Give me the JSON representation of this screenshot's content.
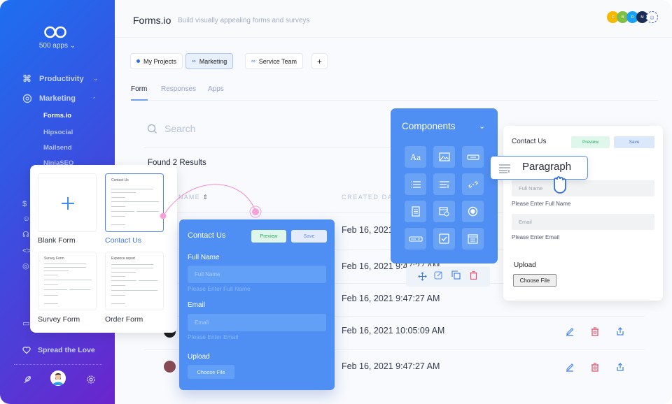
{
  "sidebar": {
    "apps_label": "500 apps",
    "nav": [
      {
        "label": "Productivity",
        "icon": "command-icon",
        "expanded": false
      },
      {
        "label": "Marketing",
        "icon": "compass-icon",
        "expanded": true
      }
    ],
    "sub_items": [
      {
        "label": "Forms.io",
        "active": true
      },
      {
        "label": "Hipsocial",
        "active": false
      },
      {
        "label": "Mailsend",
        "active": false
      },
      {
        "label": "NinjaSEO",
        "active": false
      }
    ],
    "spread_label": "Spread the Love"
  },
  "header": {
    "title": "Forms.io",
    "subtitle": "Build visually appealing forms and surveys",
    "avatars": [
      {
        "initial": "C",
        "color": "#f7b900"
      },
      {
        "initial": "B",
        "color": "#7fc043"
      },
      {
        "initial": "R",
        "color": "#1aa3f5"
      },
      {
        "initial": "M",
        "color": "#1c2d55"
      }
    ]
  },
  "workspaces": {
    "items": [
      {
        "label": "My Projects",
        "active": false
      },
      {
        "label": "Marketing",
        "active": true
      },
      {
        "label": "Service Team",
        "active": false
      }
    ],
    "add_label": "+"
  },
  "tabs": [
    {
      "label": "Form",
      "active": true
    },
    {
      "label": "Responses",
      "active": false
    },
    {
      "label": "Apps",
      "active": false
    }
  ],
  "search": {
    "placeholder": "Search"
  },
  "results": {
    "found_label": "Found 2 Results",
    "columns": {
      "name": "NAME",
      "created": "CREATED DATE"
    },
    "rows": [
      {
        "created": "Feb 16, 2021 9:47:27 AM"
      },
      {
        "created": "Feb 16, 2021 9:47:27 AM"
      },
      {
        "created": "Feb 16, 2021 9:47:27 AM"
      },
      {
        "created": "Feb 16, 2021 10:05:09 AM"
      },
      {
        "created": "Feb 16, 2021 9:47:27 AM"
      }
    ]
  },
  "templates": [
    {
      "label": "Blank Form",
      "preview_title": "",
      "selected": false
    },
    {
      "label": "Contact Us",
      "preview_title": "Contact Us",
      "selected": true
    },
    {
      "label": "Survey Form",
      "preview_title": "Survey Form",
      "selected": false
    },
    {
      "label": "Order Form",
      "preview_title": "Expence report",
      "selected": false
    }
  ],
  "blue_form": {
    "title": "Contact Us",
    "preview_label": "Preview",
    "save_label": "Save",
    "fields": [
      {
        "label": "Full Name",
        "placeholder": "Full Name",
        "hint": "Please Enter Full Name"
      },
      {
        "label": "Email",
        "placeholder": "Email",
        "hint": "Please Enter Email"
      }
    ],
    "upload_label": "Upload",
    "file_button": "Choose File"
  },
  "components": {
    "title": "Components",
    "text_icon_label": "Aa"
  },
  "white_form": {
    "title": "Contact Us",
    "preview_label": "Preview",
    "save_label": "Save",
    "fields": [
      {
        "placeholder": "Full Name",
        "hint": "Please Enter Full Name"
      },
      {
        "placeholder": "Email",
        "hint": "Please Enter Email"
      }
    ],
    "upload_label": "Upload",
    "file_button": "Choose File"
  },
  "drag_item": {
    "label": "Paragraph"
  },
  "colors": {
    "accent": "#4f8ff3",
    "danger": "#e5566d",
    "preview_green": "#dff7ea",
    "connector_pink": "#f58ad0"
  }
}
